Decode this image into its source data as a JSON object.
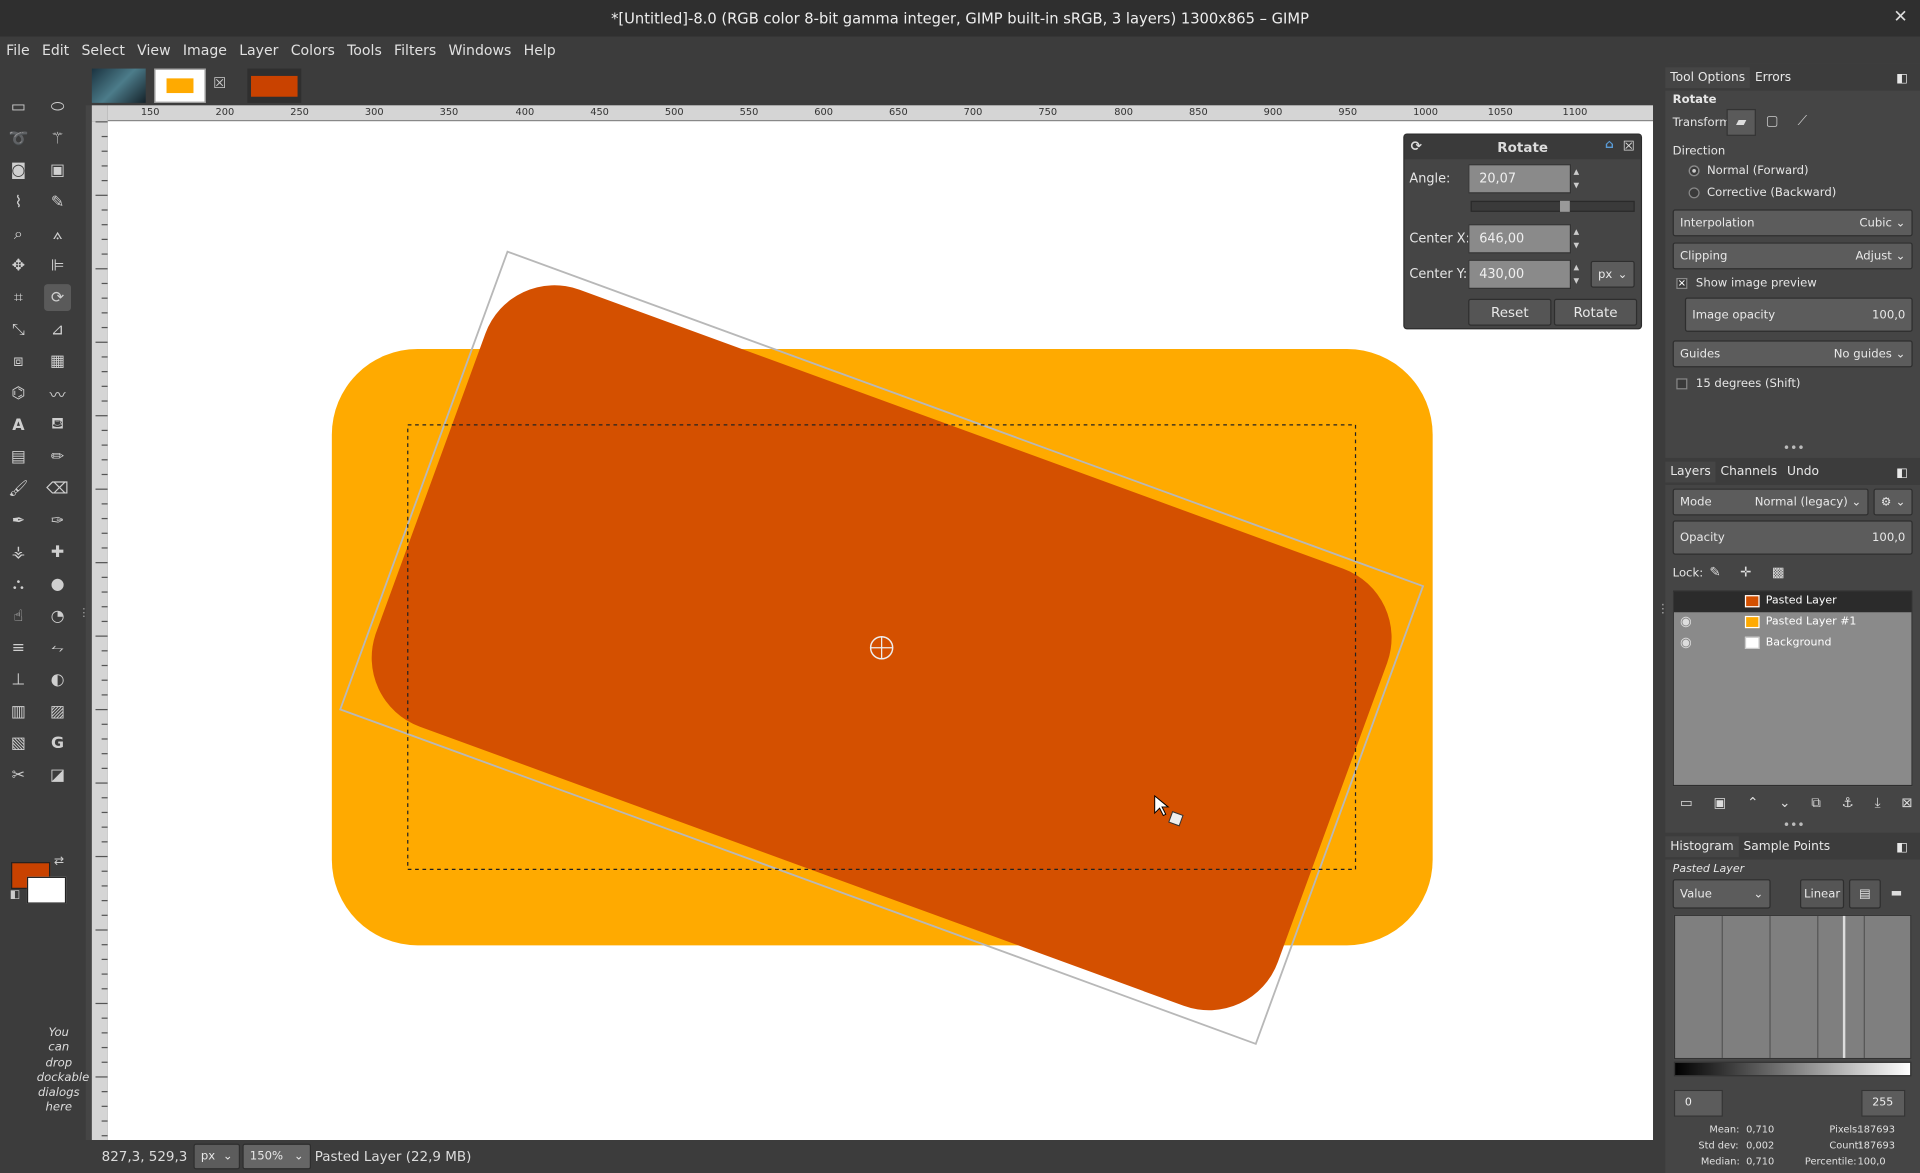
{
  "window": {
    "title": "*[Untitled]-8.0 (RGB color 8-bit gamma integer, GIMP built-in sRGB, 3 layers) 1300x865 – GIMP",
    "close": "✕"
  },
  "menu": [
    "File",
    "Edit",
    "Select",
    "View",
    "Image",
    "Layer",
    "Colors",
    "Tools",
    "Filters",
    "Windows",
    "Help"
  ],
  "toolbox": {
    "drop_message": "You can drop dockable dialogs here",
    "fg_color": "#c94200",
    "bg_color": "#ffffff"
  },
  "ruler_ticks": [
    "150",
    "200",
    "250",
    "300",
    "350",
    "400",
    "450",
    "500",
    "550",
    "600",
    "650",
    "700",
    "750",
    "800",
    "850",
    "900",
    "950",
    "1000",
    "1050",
    "1100"
  ],
  "canvas": {
    "bg_shape_color": "#ffaa00",
    "layer_color": "#d45000"
  },
  "rotate_dialog": {
    "title": "Rotate",
    "angle_label": "Angle:",
    "angle_value": "20,07",
    "cx_label": "Center X:",
    "cx_value": "646,00",
    "cy_label": "Center Y:",
    "cy_value": "430,00",
    "unit": "px",
    "reset": "Reset",
    "rotate": "Rotate"
  },
  "tool_options": {
    "tabs": [
      "Tool Options",
      "Errors"
    ],
    "tool_name": "Rotate",
    "transform_label": "Transform:",
    "direction_label": "Direction",
    "dir_normal": "Normal (Forward)",
    "dir_corrective": "Corrective (Backward)",
    "interp_label": "Interpolation",
    "interp_value": "Cubic",
    "clip_label": "Clipping",
    "clip_value": "Adjust",
    "show_preview": "Show image preview",
    "opacity_label": "Image opacity",
    "opacity_value": "100,0",
    "guides_label": "Guides",
    "guides_value": "No guides",
    "deg15": "15 degrees (Shift)"
  },
  "layers": {
    "tabs": [
      "Layers",
      "Channels",
      "Undo"
    ],
    "mode_label": "Mode",
    "mode_value": "Normal (legacy)",
    "opacity_label": "Opacity",
    "opacity_value": "100,0",
    "lock_label": "Lock:",
    "items": [
      "Pasted Layer",
      "Pasted Layer #1",
      "Background"
    ]
  },
  "histogram": {
    "tabs": [
      "Histogram",
      "Sample Points"
    ],
    "layer_name": "Pasted Layer",
    "channel": "Value",
    "scale": "Linear",
    "min": "0",
    "max": "255",
    "mean_label": "Mean:",
    "mean": "0,710",
    "std_label": "Std dev:",
    "std": "0,002",
    "median_label": "Median:",
    "median": "0,710",
    "pixels_label": "Pixels:",
    "pixels": "187693",
    "count_label": "Count:",
    "count": "187693",
    "percentile_label": "Percentile:",
    "percentile": "100,0"
  },
  "status": {
    "coords": "827,3, 529,3",
    "unit": "px",
    "zoom": "150%",
    "info": "Pasted Layer (22,9 MB)"
  }
}
